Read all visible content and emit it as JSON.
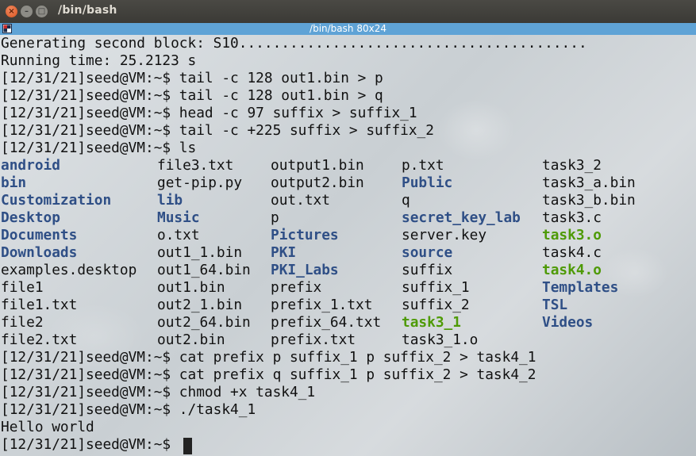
{
  "window": {
    "title": "/bin/bash",
    "tab_title": "/bin/bash 80x24",
    "close_glyph": "×",
    "minimize_glyph": "–",
    "maximize_glyph": "□"
  },
  "terminal": {
    "top_lines": [
      "Generating second block: S10.........................................",
      "Running time: 25.2123 s",
      "[12/31/21]seed@VM:~$ tail -c 128 out1.bin > p",
      "[12/31/21]seed@VM:~$ tail -c 128 out1.bin > q",
      "[12/31/21]seed@VM:~$ head -c 97 suffix > suffix_1",
      "[12/31/21]seed@VM:~$ tail -c +225 suffix > suffix_2",
      "[12/31/21]seed@VM:~$ ls"
    ],
    "ls_columns": [
      [
        {
          "name": "android",
          "type": "dir"
        },
        {
          "name": "bin",
          "type": "dir"
        },
        {
          "name": "Customization",
          "type": "dir"
        },
        {
          "name": "Desktop",
          "type": "dir"
        },
        {
          "name": "Documents",
          "type": "dir"
        },
        {
          "name": "Downloads",
          "type": "dir"
        },
        {
          "name": "examples.desktop",
          "type": "file"
        },
        {
          "name": "file1",
          "type": "file"
        },
        {
          "name": "file1.txt",
          "type": "file"
        },
        {
          "name": "file2",
          "type": "file"
        },
        {
          "name": "file2.txt",
          "type": "file"
        }
      ],
      [
        {
          "name": "file3.txt",
          "type": "file"
        },
        {
          "name": "get-pip.py",
          "type": "file"
        },
        {
          "name": "lib",
          "type": "dir"
        },
        {
          "name": "Music",
          "type": "dir"
        },
        {
          "name": "o.txt",
          "type": "file"
        },
        {
          "name": "out1_1.bin",
          "type": "file"
        },
        {
          "name": "out1_64.bin",
          "type": "file"
        },
        {
          "name": "out1.bin",
          "type": "file"
        },
        {
          "name": "out2_1.bin",
          "type": "file"
        },
        {
          "name": "out2_64.bin",
          "type": "file"
        },
        {
          "name": "out2.bin",
          "type": "file"
        }
      ],
      [
        {
          "name": "output1.bin",
          "type": "file"
        },
        {
          "name": "output2.bin",
          "type": "file"
        },
        {
          "name": "out.txt",
          "type": "file"
        },
        {
          "name": "p",
          "type": "file"
        },
        {
          "name": "Pictures",
          "type": "dir"
        },
        {
          "name": "PKI",
          "type": "dir"
        },
        {
          "name": "PKI_Labs",
          "type": "dir"
        },
        {
          "name": "prefix",
          "type": "file"
        },
        {
          "name": "prefix_1.txt",
          "type": "file"
        },
        {
          "name": "prefix_64.txt",
          "type": "file"
        },
        {
          "name": "prefix.txt",
          "type": "file"
        }
      ],
      [
        {
          "name": "p.txt",
          "type": "file"
        },
        {
          "name": "Public",
          "type": "dir"
        },
        {
          "name": "q",
          "type": "file"
        },
        {
          "name": "secret_key_lab",
          "type": "dir"
        },
        {
          "name": "server.key",
          "type": "file"
        },
        {
          "name": "source",
          "type": "dir"
        },
        {
          "name": "suffix",
          "type": "file"
        },
        {
          "name": "suffix_1",
          "type": "file"
        },
        {
          "name": "suffix_2",
          "type": "file"
        },
        {
          "name": "task3_1",
          "type": "exec"
        },
        {
          "name": "task3_1.o",
          "type": "file"
        }
      ],
      [
        {
          "name": "task3_2",
          "type": "file"
        },
        {
          "name": "task3_a.bin",
          "type": "file"
        },
        {
          "name": "task3_b.bin",
          "type": "file"
        },
        {
          "name": "task3.c",
          "type": "file"
        },
        {
          "name": "task3.o",
          "type": "exec"
        },
        {
          "name": "task4.c",
          "type": "file"
        },
        {
          "name": "task4.o",
          "type": "exec"
        },
        {
          "name": "Templates",
          "type": "dir"
        },
        {
          "name": "TSL",
          "type": "dir"
        },
        {
          "name": "Videos",
          "type": "dir"
        }
      ]
    ],
    "bottom_lines": [
      "[12/31/21]seed@VM:~$ cat prefix p suffix_1 p suffix_2 > task4_1",
      "[12/31/21]seed@VM:~$ cat prefix q suffix_1 p suffix_2 > task4_2",
      "[12/31/21]seed@VM:~$ chmod +x task4_1",
      "[12/31/21]seed@VM:~$ ./task4_1",
      "Hello world",
      "[12/31/21]seed@VM:~$ "
    ]
  },
  "colors": {
    "tab_bar": "#5fa3d6",
    "directory": "#2f4f86",
    "executable": "#4e9a06",
    "text": "#111111"
  },
  "icons": {
    "close": "close-icon",
    "minimize": "minimize-icon",
    "maximize": "maximize-icon",
    "terminal": "terminal-icon"
  }
}
